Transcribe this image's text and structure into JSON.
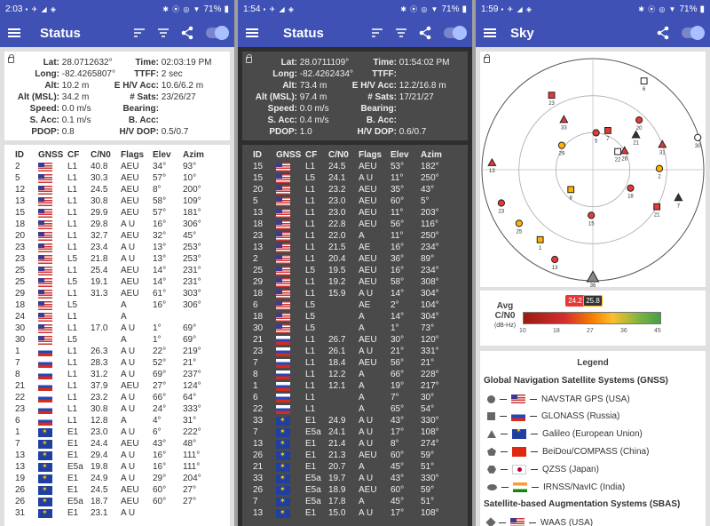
{
  "panels": [
    {
      "time": "2:03",
      "battery": "71%",
      "title": "Status",
      "loc": {
        "lat": "28.0712632°",
        "long": "-82.4265807°",
        "alt": "10.2 m",
        "alt_msl": "34.2 m",
        "speed": "0.0 m/s",
        "s_acc": "0.1 m/s",
        "pdop": "0.8",
        "time": "02:03:19 PM",
        "ttff": "2 sec",
        "eh_acc": "10.6/6.2 m",
        "sats": "23/26/27",
        "bearing": "",
        "b_acc": "",
        "hv_dop": "0.5/0.7"
      },
      "rows": [
        [
          "2",
          "us",
          "L1",
          "40.8",
          "AEU",
          "34°",
          "93°"
        ],
        [
          "5",
          "us",
          "L1",
          "30.3",
          "AEU",
          "57°",
          "10°"
        ],
        [
          "12",
          "us",
          "L1",
          "24.5",
          "AEU",
          "8°",
          "200°"
        ],
        [
          "13",
          "us",
          "L1",
          "30.8",
          "AEU",
          "58°",
          "109°"
        ],
        [
          "15",
          "us",
          "L1",
          "29.9",
          "AEU",
          "57°",
          "181°"
        ],
        [
          "18",
          "us",
          "L1",
          "29.8",
          "A U",
          "16°",
          "306°"
        ],
        [
          "20",
          "us",
          "L1",
          "32.7",
          "AEU",
          "32°",
          "45°"
        ],
        [
          "23",
          "us",
          "L1",
          "23.4",
          "A U",
          "13°",
          "253°"
        ],
        [
          "23",
          "us",
          "L5",
          "21.8",
          "A U",
          "13°",
          "253°"
        ],
        [
          "25",
          "us",
          "L1",
          "25.4",
          "AEU",
          "14°",
          "231°"
        ],
        [
          "25",
          "us",
          "L5",
          "19.1",
          "AEU",
          "14°",
          "231°"
        ],
        [
          "29",
          "us",
          "L1",
          "31.3",
          "AEU",
          "61°",
          "303°"
        ],
        [
          "18",
          "us",
          "L5",
          "",
          "A",
          "16°",
          "306°"
        ],
        [
          "24",
          "us",
          "L1",
          "",
          "A",
          "",
          ""
        ],
        [
          "30",
          "us",
          "L1",
          "17.0",
          "A U",
          "1°",
          "69°"
        ],
        [
          "30",
          "us",
          "L5",
          "",
          "A",
          "1°",
          "69°"
        ],
        [
          "1",
          "ru",
          "L1",
          "26.3",
          "A U",
          "22°",
          "219°"
        ],
        [
          "7",
          "ru",
          "L1",
          "28.3",
          "A U",
          "52°",
          "21°"
        ],
        [
          "8",
          "ru",
          "L1",
          "31.2",
          "A U",
          "69°",
          "237°"
        ],
        [
          "21",
          "ru",
          "L1",
          "37.9",
          "AEU",
          "27°",
          "124°"
        ],
        [
          "22",
          "ru",
          "L1",
          "23.2",
          "A U",
          "66°",
          "64°"
        ],
        [
          "23",
          "ru",
          "L1",
          "30.8",
          "A U",
          "24°",
          "333°"
        ],
        [
          "6",
          "ru",
          "L1",
          "12.8",
          "A",
          "4°",
          "31°"
        ],
        [
          "1",
          "eu",
          "E1",
          "23.0",
          "A U",
          "6°",
          "222°"
        ],
        [
          "7",
          "eu",
          "E1",
          "24.4",
          "AEU",
          "43°",
          "48°"
        ],
        [
          "13",
          "eu",
          "E1",
          "29.4",
          "A U",
          "16°",
          "111°"
        ],
        [
          "13",
          "eu",
          "E5a",
          "19.8",
          "A U",
          "16°",
          "111°"
        ],
        [
          "19",
          "eu",
          "E1",
          "24.9",
          "A U",
          "29°",
          "204°"
        ],
        [
          "26",
          "eu",
          "E1",
          "24.5",
          "AEU",
          "60°",
          "27°"
        ],
        [
          "26",
          "eu",
          "E5a",
          "18.7",
          "AEU",
          "60°",
          "27°"
        ],
        [
          "31",
          "eu",
          "E1",
          "23.1",
          "A U",
          "",
          "",
          ""
        ]
      ]
    },
    {
      "time": "1:54",
      "battery": "71%",
      "title": "Status",
      "loc": {
        "lat": "28.0711109°",
        "long": "-82.4262434°",
        "alt": "73.4 m",
        "alt_msl": "97.4 m",
        "speed": "0.0 m/s",
        "s_acc": "0.4 m/s",
        "pdop": "1.0",
        "time": "01:54:02 PM",
        "ttff": "",
        "eh_acc": "12.2/16.8 m",
        "sats": "17/21/27",
        "bearing": "",
        "b_acc": "",
        "hv_dop": "0.6/0.7"
      },
      "rows": [
        [
          "15",
          "us",
          "L1",
          "24.5",
          "AEU",
          "53°",
          "182°"
        ],
        [
          "15",
          "us",
          "L5",
          "24.1",
          "A U",
          "11°",
          "250°"
        ],
        [
          "20",
          "us",
          "L1",
          "23.2",
          "AEU",
          "35°",
          "43°"
        ],
        [
          "5",
          "us",
          "L1",
          "23.0",
          "AEU",
          "60°",
          "5°"
        ],
        [
          "13",
          "us",
          "L1",
          "23.0",
          "AEU",
          "11°",
          "203°"
        ],
        [
          "18",
          "us",
          "L1",
          "22.8",
          "AEU",
          "56°",
          "116°"
        ],
        [
          "23",
          "us",
          "L1",
          "22.0",
          "A",
          "11°",
          "250°"
        ],
        [
          "13",
          "us",
          "L1",
          "21.5",
          "AE",
          "16°",
          "234°"
        ],
        [
          "2",
          "us",
          "L1",
          "20.4",
          "AEU",
          "36°",
          "89°"
        ],
        [
          "25",
          "us",
          "L5",
          "19.5",
          "AEU",
          "16°",
          "234°"
        ],
        [
          "29",
          "us",
          "L1",
          "19.2",
          "AEU",
          "58°",
          "308°"
        ],
        [
          "18",
          "us",
          "L1",
          "15.9",
          "A U",
          "14°",
          "304°"
        ],
        [
          "6",
          "us",
          "L5",
          "",
          "AE",
          "2°",
          "104°"
        ],
        [
          "18",
          "us",
          "L5",
          "",
          "A",
          "14°",
          "304°"
        ],
        [
          "30",
          "us",
          "L5",
          "",
          "A",
          "1°",
          "73°"
        ],
        [
          "21",
          "ru",
          "L1",
          "26.7",
          "AEU",
          "30°",
          "120°"
        ],
        [
          "23",
          "ru",
          "L1",
          "26.1",
          "A U",
          "21°",
          "331°"
        ],
        [
          "7",
          "ru",
          "L1",
          "18.4",
          "AEU",
          "56°",
          "21°"
        ],
        [
          "8",
          "ru",
          "L1",
          "12.2",
          "A",
          "66°",
          "228°"
        ],
        [
          "1",
          "ru",
          "L1",
          "12.1",
          "A",
          "19°",
          "217°"
        ],
        [
          "6",
          "ru",
          "L1",
          "",
          "A",
          "7°",
          "30°"
        ],
        [
          "22",
          "ru",
          "L1",
          "",
          "A",
          "65°",
          "54°"
        ],
        [
          "33",
          "eu",
          "E1",
          "24.9",
          "A U",
          "43°",
          "330°"
        ],
        [
          "7",
          "eu",
          "E5a",
          "24.1",
          "A U",
          "17°",
          "108°"
        ],
        [
          "13",
          "eu",
          "E1",
          "21.4",
          "A U",
          "8°",
          "274°"
        ],
        [
          "26",
          "eu",
          "E1",
          "21.3",
          "AEU",
          "60°",
          "59°"
        ],
        [
          "21",
          "eu",
          "E1",
          "20.7",
          "A",
          "45°",
          "51°"
        ],
        [
          "33",
          "eu",
          "E5a",
          "19.7",
          "A U",
          "43°",
          "330°"
        ],
        [
          "26",
          "eu",
          "E5a",
          "18.9",
          "AEU",
          "60°",
          "59°"
        ],
        [
          "7",
          "eu",
          "E5a",
          "17.8",
          "A",
          "45°",
          "51°"
        ],
        [
          "13",
          "eu",
          "E1",
          "15.0",
          "A U",
          "17°",
          "108°"
        ]
      ]
    },
    {
      "time": "1:59",
      "battery": "71%",
      "title": "Sky"
    }
  ],
  "labels": {
    "lat": "Lat:",
    "long": "Long:",
    "alt": "Alt:",
    "alt_msl": "Alt (MSL):",
    "speed": "Speed:",
    "s_acc": "S. Acc:",
    "pdop": "PDOP:",
    "time": "Time:",
    "ttff": "TTFF:",
    "eh_acc": "E H/V Acc:",
    "sats": "# Sats:",
    "bearing": "Bearing:",
    "b_acc": "B. Acc:",
    "hv_dop": "H/V DOP:"
  },
  "columns": [
    "ID",
    "GNSS",
    "CF",
    "C/N0",
    "Flags",
    "Elev",
    "Azim"
  ],
  "sky": {
    "avg_label": "Avg",
    "cn0_label": "C/N0",
    "unit_label": "(dB-Hz)",
    "avg_in_use": "25.8",
    "avg_in_view": "24.2",
    "ticks": [
      "10",
      "18",
      "27",
      "36",
      "45"
    ],
    "legend_title": "Legend",
    "gnss_heading": "Global Navigation Satellite Systems (GNSS)",
    "sbas_heading": "Satellite-based Augmentation Systems (SBAS)",
    "gnss": [
      {
        "shape": "circle",
        "flag": "us",
        "label": "NAVSTAR GPS (USA)"
      },
      {
        "shape": "square",
        "flag": "ru",
        "label": "GLONASS (Russia)"
      },
      {
        "shape": "triangle",
        "flag": "eu",
        "label": "Galileo (European Union)"
      },
      {
        "shape": "pentagon",
        "flag": "cn",
        "label": "BeiDou/COMPASS (China)"
      },
      {
        "shape": "hexagon",
        "flag": "jp",
        "label": "QZSS (Japan)"
      },
      {
        "shape": "oval",
        "flag": "in",
        "label": "IRNSS/NavIC (India)"
      }
    ],
    "sbas": [
      {
        "shape": "diamond",
        "flag": "us",
        "label": "WAAS (USA)"
      }
    ],
    "sats": [
      {
        "id": "15",
        "shape": "circle",
        "color": "#e53935",
        "az": 182,
        "el": 53
      },
      {
        "id": "20",
        "shape": "circle",
        "color": "#e53935",
        "az": 43,
        "el": 35
      },
      {
        "id": "5",
        "shape": "circle",
        "color": "#e53935",
        "az": 5,
        "el": 60
      },
      {
        "id": "13",
        "shape": "circle",
        "color": "#e53935",
        "az": 203,
        "el": 11
      },
      {
        "id": "18",
        "shape": "circle",
        "color": "#e53935",
        "az": 116,
        "el": 56
      },
      {
        "id": "23",
        "shape": "circle",
        "color": "#e53935",
        "az": 250,
        "el": 11
      },
      {
        "id": "2",
        "shape": "circle",
        "color": "#ffb300",
        "az": 89,
        "el": 36
      },
      {
        "id": "25",
        "shape": "circle",
        "color": "#ffb300",
        "az": 234,
        "el": 16
      },
      {
        "id": "29",
        "shape": "circle",
        "color": "#ffb300",
        "az": 308,
        "el": 58
      },
      {
        "id": "30",
        "shape": "circle",
        "color": "#ffffff",
        "az": 73,
        "el": 1
      },
      {
        "id": "21",
        "shape": "square",
        "color": "#e53935",
        "az": 120,
        "el": 30
      },
      {
        "id": "23",
        "shape": "square",
        "color": "#e53935",
        "az": 331,
        "el": 21
      },
      {
        "id": "7",
        "shape": "square",
        "color": "#e53935",
        "az": 21,
        "el": 56
      },
      {
        "id": "8",
        "shape": "square",
        "color": "#ffb300",
        "az": 228,
        "el": 66
      },
      {
        "id": "1",
        "shape": "square",
        "color": "#ffb300",
        "az": 217,
        "el": 19
      },
      {
        "id": "6",
        "shape": "square",
        "color": "#ffffff",
        "az": 30,
        "el": 7
      },
      {
        "id": "22",
        "shape": "square",
        "color": "#ffffff",
        "az": 54,
        "el": 65
      },
      {
        "id": "33",
        "shape": "triangle",
        "color": "#e53935",
        "az": 330,
        "el": 43
      },
      {
        "id": "13",
        "shape": "triangle",
        "color": "#e53935",
        "az": 274,
        "el": 8
      },
      {
        "id": "26",
        "shape": "triangle",
        "color": "#e53935",
        "az": 59,
        "el": 60
      },
      {
        "id": "21",
        "shape": "triangle",
        "color": "#333333",
        "az": 51,
        "el": 45
      },
      {
        "id": "7",
        "shape": "triangle",
        "color": "#333333",
        "az": 108,
        "el": 17
      },
      {
        "id": "31",
        "shape": "triangle",
        "color": "#e53935",
        "az": 70,
        "el": 30
      },
      {
        "id": "36",
        "shape": "triangle",
        "color": "#888888",
        "az": 180,
        "el": 3
      }
    ]
  }
}
